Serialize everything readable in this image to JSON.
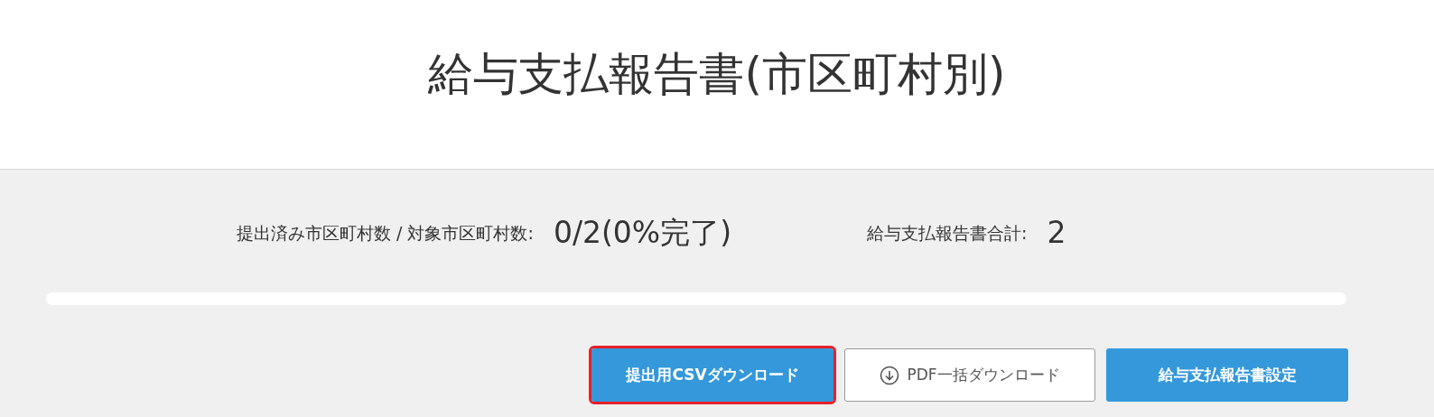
{
  "title": "給与支払報告書(市区町村別)",
  "stats": [
    {
      "label": "提出済み市区町村数 / 対象市区町村数:",
      "value": "0/2(0%完了)"
    },
    {
      "label": "給与支払報告書合計:",
      "value": "2"
    }
  ],
  "progress": {
    "level": 0
  },
  "buttons": [
    {
      "label": "提出用CSVダウンロード",
      "kind": "primary",
      "highlighted": true
    },
    {
      "label": "PDF一括ダウンロード",
      "kind": "download",
      "highlighted": false
    },
    {
      "label": "給与支払報告書設定",
      "kind": "primary",
      "highlighted": false
    }
  ]
}
